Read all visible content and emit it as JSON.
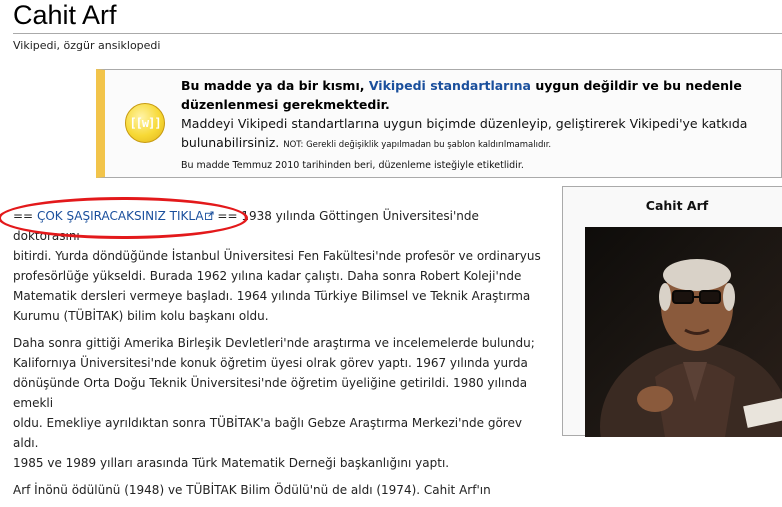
{
  "page": {
    "title": "Cahit Arf",
    "subtitle": "Vikipedi, özgür ansiklopedi"
  },
  "notice": {
    "icon_text": "[[w]]",
    "line1_before": "Bu madde ya da bir kısmı, ",
    "line1_link": "Vikipedi standartlarına",
    "line1_after": " uygun değildir ve bu nedenle",
    "line1_b": "düzenlenmesi gerekmektedir.",
    "line2_a": "Maddeyi Vikipedi standartlarına uygun biçimde düzenleyip, geliştirerek Vikipedi'ye katkıda",
    "line2_b": "bulunabilirsiniz. ",
    "note": "NOT: Gerekli değişiklik yapılmadan bu şablon kaldırılmamalıdır.",
    "line3": "Bu madde Temmuz 2010 tarihinden beri, düzenleme isteğiyle etiketlidir.",
    "colors": {
      "accent": "#f2c44a",
      "link": "#1a4f9c"
    }
  },
  "article": {
    "p1_prefix": "== ",
    "p1_link": "ÇOK ŞAŞIRACAKSINIZ TIKLA",
    "p1_suffix": " == 1938 yılında Göttingen Üniversitesi'nde doktorasını",
    "p1_l2": "bitirdi. Yurda döndüğünde İstanbul Üniversitesi Fen Fakültesi'nde profesör ve ordinaryus",
    "p1_l3": "profesörlüğe yükseldi. Burada 1962 yılına kadar çalıştı. Daha sonra Robert Koleji'nde",
    "p1_l4": "Matematik dersleri vermeye başladı. 1964 yılında Türkiye Bilimsel ve Teknik Araştırma",
    "p1_l5": "Kurumu (TÜBİTAK) bilim kolu başkanı oldu.",
    "p2_l1": "Daha sonra gittiği Amerika Birleşik Devletleri'nde araştırma ve incelemelerde bulundu;",
    "p2_l2": "Kalifornıya Üniversitesi'nde konuk öğretim üyesi olrak görev yaptı. 1967 yılında yurda",
    "p2_l3": "dönüşünde Orta Doğu Teknik Üniversitesi'nde öğretim üyeliğine getirildi. 1980 yılında emekli",
    "p2_l4": "oldu. Emekliye ayrıldıktan sonra TÜBİTAK'a bağlı Gebze Araştırma Merkezi'nde görev aldı.",
    "p2_l5": "1985 ve 1989 yılları arasında Türk Matematik Derneği başkanlığını yaptı.",
    "p3_l1": "Arf İnönü ödülünü (1948) ve TÜBİTAK Bilim Ödülü'nü de aldı (1974). Cahit Arf'ın"
  },
  "infobox": {
    "title": "Cahit Arf"
  },
  "highlight_color": "#e3191b"
}
